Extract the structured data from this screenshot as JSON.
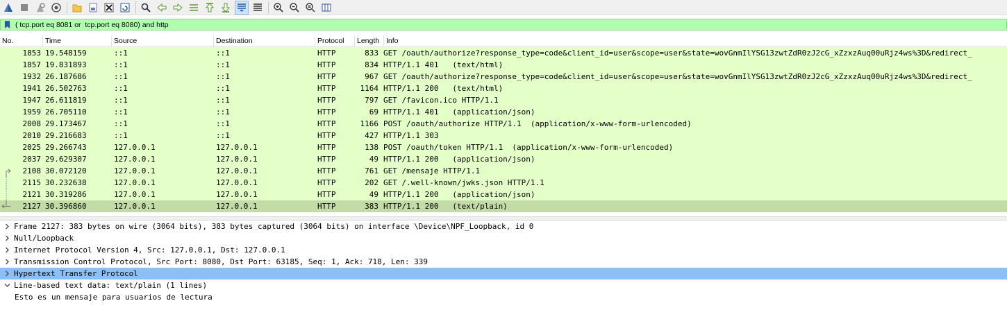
{
  "toolbar": {
    "buttons": [
      "shark-fin-start-icon",
      "stop-square-icon",
      "restart-capture-icon",
      "capture-options-icon",
      "open-folder-icon",
      "save-file-icon",
      "close-file-icon",
      "reload-file-icon",
      "find-packet-icon",
      "go-back-icon",
      "go-forward-icon",
      "go-to-packet-icon",
      "go-first-icon",
      "go-last-icon",
      "auto-scroll-icon",
      "colorize-icon",
      "zoom-in-icon",
      "zoom-out-icon",
      "zoom-normal-icon",
      "resize-columns-icon"
    ],
    "active": [
      "auto-scroll-icon"
    ]
  },
  "filter": {
    "text": "( tcp.port eq 8081 or  tcp.port eq 8080) and http",
    "bg_color": "#afffaf"
  },
  "packet_list": {
    "columns": [
      "No.",
      "Time",
      "Source",
      "Destination",
      "Protocol",
      "Length",
      "Info"
    ],
    "row_color": "#e4ffc7",
    "selected_color": "#c3dca7",
    "rows": [
      {
        "no": "1853",
        "time": "19.548159",
        "src": "::1",
        "dst": "::1",
        "proto": "HTTP",
        "len": "833",
        "info": "GET /oauth/authorize?response_type=code&client_id=user&scope=user&state=wovGnmIlYSG13zwtZdR0zJ2cG_xZzxzAuq00uRjz4ws%3D&redirect_"
      },
      {
        "no": "1857",
        "time": "19.831893",
        "src": "::1",
        "dst": "::1",
        "proto": "HTTP",
        "len": "834",
        "info": "HTTP/1.1 401   (text/html)"
      },
      {
        "no": "1932",
        "time": "26.187686",
        "src": "::1",
        "dst": "::1",
        "proto": "HTTP",
        "len": "967",
        "info": "GET /oauth/authorize?response_type=code&client_id=user&scope=user&state=wovGnmIlYSG13zwtZdR0zJ2cG_xZzxzAuq00uRjz4ws%3D&redirect_"
      },
      {
        "no": "1941",
        "time": "26.502763",
        "src": "::1",
        "dst": "::1",
        "proto": "HTTP",
        "len": "1164",
        "info": "HTTP/1.1 200   (text/html)"
      },
      {
        "no": "1947",
        "time": "26.611819",
        "src": "::1",
        "dst": "::1",
        "proto": "HTTP",
        "len": "797",
        "info": "GET /favicon.ico HTTP/1.1"
      },
      {
        "no": "1959",
        "time": "26.705110",
        "src": "::1",
        "dst": "::1",
        "proto": "HTTP",
        "len": "69",
        "info": "HTTP/1.1 401   (application/json)"
      },
      {
        "no": "2008",
        "time": "29.173467",
        "src": "::1",
        "dst": "::1",
        "proto": "HTTP",
        "len": "1166",
        "info": "POST /oauth/authorize HTTP/1.1  (application/x-www-form-urlencoded)"
      },
      {
        "no": "2010",
        "time": "29.216683",
        "src": "::1",
        "dst": "::1",
        "proto": "HTTP",
        "len": "427",
        "info": "HTTP/1.1 303"
      },
      {
        "no": "2025",
        "time": "29.266743",
        "src": "127.0.0.1",
        "dst": "127.0.0.1",
        "proto": "HTTP",
        "len": "138",
        "info": "POST /oauth/token HTTP/1.1  (application/x-www-form-urlencoded)"
      },
      {
        "no": "2037",
        "time": "29.629307",
        "src": "127.0.0.1",
        "dst": "127.0.0.1",
        "proto": "HTTP",
        "len": "49",
        "info": "HTTP/1.1 200   (application/json)"
      },
      {
        "no": "2108",
        "time": "30.072120",
        "src": "127.0.0.1",
        "dst": "127.0.0.1",
        "proto": "HTTP",
        "len": "761",
        "info": "GET /mensaje HTTP/1.1"
      },
      {
        "no": "2115",
        "time": "30.232638",
        "src": "127.0.0.1",
        "dst": "127.0.0.1",
        "proto": "HTTP",
        "len": "202",
        "info": "GET /.well-known/jwks.json HTTP/1.1"
      },
      {
        "no": "2121",
        "time": "30.319286",
        "src": "127.0.0.1",
        "dst": "127.0.0.1",
        "proto": "HTTP",
        "len": "49",
        "info": "HTTP/1.1 200   (application/json)"
      },
      {
        "no": "2127",
        "time": "30.396860",
        "src": "127.0.0.1",
        "dst": "127.0.0.1",
        "proto": "HTTP",
        "len": "383",
        "info": "HTTP/1.1 200   (text/plain)"
      }
    ]
  },
  "details": {
    "selected_color": "#8cbff5",
    "items": [
      {
        "text": "Frame 2127: 383 bytes on wire (3064 bits), 383 bytes captured (3064 bits) on interface \\Device\\NPF_Loopback, id 0",
        "expand": "collapsed"
      },
      {
        "text": "Null/Loopback",
        "expand": "collapsed"
      },
      {
        "text": "Internet Protocol Version 4, Src: 127.0.0.1, Dst: 127.0.0.1",
        "expand": "collapsed"
      },
      {
        "text": "Transmission Control Protocol, Src Port: 8080, Dst Port: 63185, Seq: 1, Ack: 718, Len: 339",
        "expand": "collapsed"
      },
      {
        "text": "Hypertext Transfer Protocol",
        "expand": "collapsed",
        "selected": true
      },
      {
        "text": "Line-based text data: text/plain (1 lines)",
        "expand": "expanded"
      },
      {
        "text": "Esto es un mensaje para usuarios de lectura",
        "expand": "none",
        "child": true
      }
    ]
  }
}
